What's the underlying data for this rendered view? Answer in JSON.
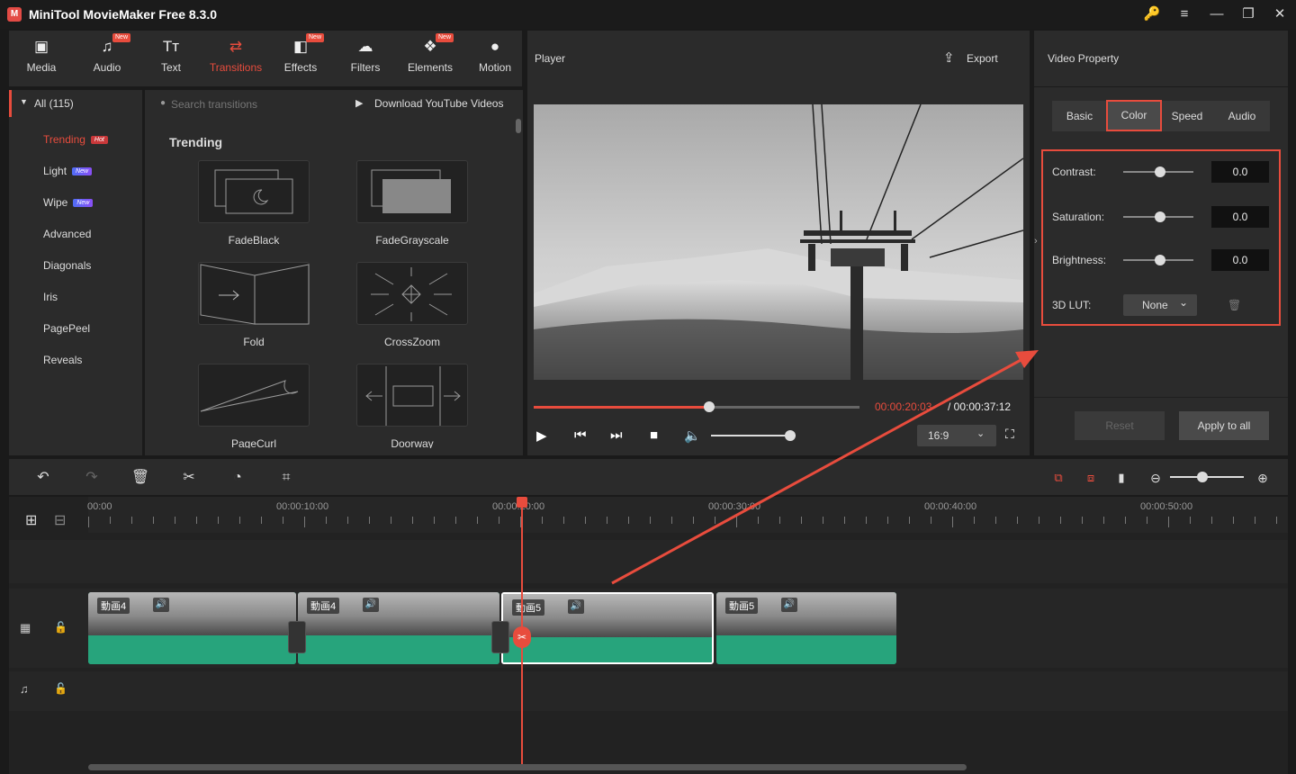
{
  "app": {
    "title": "MiniTool MovieMaker Free 8.3.0",
    "logo_letter": "M"
  },
  "window_controls": {
    "key": "🔑",
    "menu": "≡",
    "minimize": "—",
    "maximize": "❐",
    "close": "✕"
  },
  "toolbar": {
    "tabs": [
      {
        "label": "Media",
        "icon": "media-icon",
        "glyph": "▣",
        "new": false
      },
      {
        "label": "Audio",
        "icon": "audio-icon",
        "glyph": "♫",
        "new": true
      },
      {
        "label": "Text",
        "icon": "text-icon",
        "glyph": "Tт",
        "new": false
      },
      {
        "label": "Transitions",
        "icon": "transitions-icon",
        "glyph": "⇄",
        "new": false,
        "active": true
      },
      {
        "label": "Effects",
        "icon": "effects-icon",
        "glyph": "◧",
        "new": true
      },
      {
        "label": "Filters",
        "icon": "filters-icon",
        "glyph": "☁",
        "new": false
      },
      {
        "label": "Elements",
        "icon": "elements-icon",
        "glyph": "❖",
        "new": true
      },
      {
        "label": "Motion",
        "icon": "motion-icon",
        "glyph": "●",
        "new": false
      }
    ],
    "new_tag": "New"
  },
  "sidebar": {
    "all_label": "All (115)",
    "categories": [
      {
        "label": "Trending",
        "tag": "Hot",
        "active": true
      },
      {
        "label": "Light",
        "tag": "New"
      },
      {
        "label": "Wipe",
        "tag": "New"
      },
      {
        "label": "Advanced"
      },
      {
        "label": "Diagonals"
      },
      {
        "label": "Iris"
      },
      {
        "label": "PagePeel"
      },
      {
        "label": "Reveals"
      }
    ]
  },
  "library": {
    "search_placeholder": "Search transitions",
    "download_label": "Download YouTube Videos",
    "section_title": "Trending",
    "items": [
      "FadeBlack",
      "FadeGrayscale",
      "Fold",
      "CrossZoom",
      "PageCurl",
      "Doorway"
    ]
  },
  "player": {
    "title": "Player",
    "export_label": "Export",
    "current_time": "00:00:20:03",
    "total_time": "/ 00:00:37:12",
    "progress": 0.54,
    "volume": 0.94,
    "aspect_ratio": "16:9"
  },
  "properties": {
    "title": "Video Property",
    "tabs": [
      "Basic",
      "Color",
      "Speed",
      "Audio"
    ],
    "active_tab": "Color",
    "contrast": {
      "label": "Contrast:",
      "value": "0.0"
    },
    "saturation": {
      "label": "Saturation:",
      "value": "0.0"
    },
    "brightness": {
      "label": "Brightness:",
      "value": "0.0"
    },
    "lut": {
      "label": "3D LUT:",
      "value": "None"
    },
    "reset_label": "Reset",
    "apply_all_label": "Apply to all"
  },
  "timeline": {
    "ruler": [
      "00:00",
      "00:00:10:00",
      "00:00:20:00",
      "00:00:30:00",
      "00:00:40:00",
      "00:00:50:00"
    ],
    "clips": [
      {
        "label": "動画4"
      },
      {
        "label": "動画4"
      },
      {
        "label": "動画5",
        "selected": true
      },
      {
        "label": "動画5"
      }
    ]
  },
  "colors": {
    "accent": "#e84c3d",
    "panel": "#2b2b2b",
    "bg": "#1a1a1a",
    "clip_audio": "#27a47c"
  }
}
